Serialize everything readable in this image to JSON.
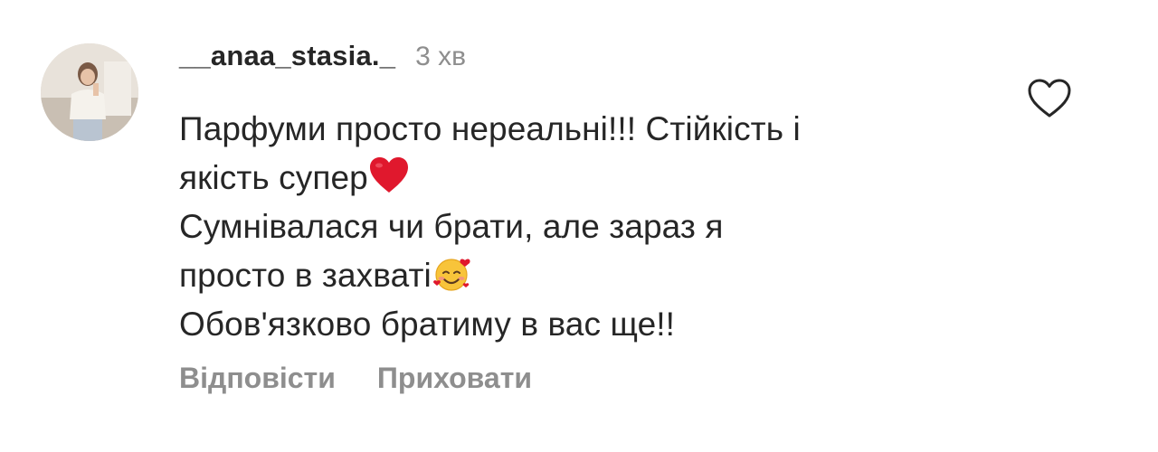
{
  "comment": {
    "username": "__anaa_stasia._",
    "time": "3 хв",
    "lines": [
      "Парфуми просто нереальні!!! Стійкість і",
      "якість супер",
      "Сумнівалася чи брати, але зараз я",
      "просто в захваті",
      "Обов'язково братиму в вас ще!!"
    ],
    "emojis": {
      "line2": "red-heart-emoji",
      "line4": "smiling-face-with-hearts-emoji"
    },
    "actions": {
      "reply": "Відповісти",
      "hide": "Приховати"
    },
    "like_icon": "heart-outline-icon"
  },
  "colors": {
    "text": "#262626",
    "muted": "#8e8e8e",
    "heart": "#e0182d"
  }
}
